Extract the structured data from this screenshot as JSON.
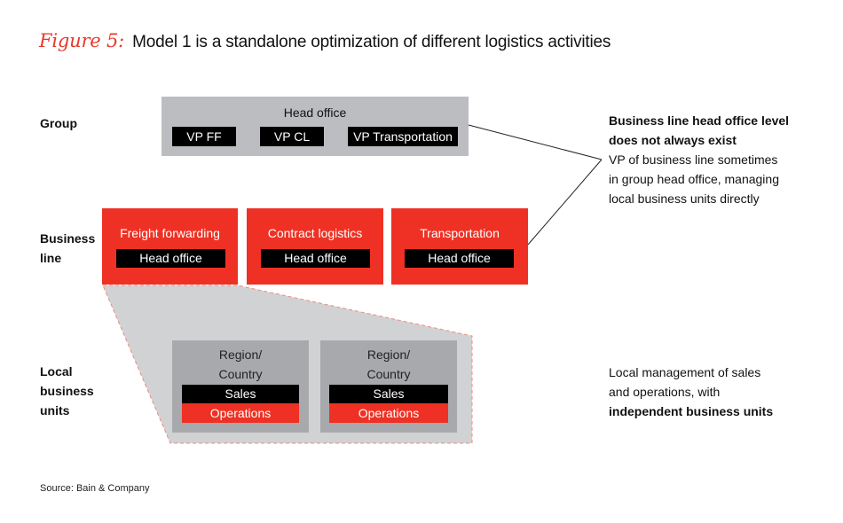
{
  "figure": {
    "label": "Figure 5:",
    "title": "Model 1 is a standalone optimization of different logistics activities"
  },
  "row_labels": {
    "group": "Group",
    "business_line": [
      "Business",
      "line"
    ],
    "local_units": [
      "Local",
      "business",
      "units"
    ]
  },
  "group_level": {
    "title": "Head office",
    "vps": [
      "VP FF",
      "VP CL",
      "VP Transportation"
    ]
  },
  "business_lines": [
    {
      "name": "Freight forwarding",
      "sub": "Head office"
    },
    {
      "name": "Contract logistics",
      "sub": "Head office"
    },
    {
      "name": "Transportation",
      "sub": "Head office"
    }
  ],
  "local_units": [
    {
      "title": [
        "Region/",
        "Country"
      ],
      "sales": "Sales",
      "operations": "Operations"
    },
    {
      "title": [
        "Region/",
        "Country"
      ],
      "sales": "Sales",
      "operations": "Operations"
    }
  ],
  "notes": {
    "top": {
      "bold_lines": [
        "Business line head office level",
        "does not always exist"
      ],
      "lines": [
        "VP of business line sometimes",
        "in group head office, managing",
        "local business units directly"
      ]
    },
    "bottom": {
      "lines": [
        "Local management of sales",
        "and operations, with"
      ],
      "bold_line": "independent business units"
    }
  },
  "source": "Source: Bain & Company",
  "colors": {
    "accent_red": "#ee3124",
    "gray_light": "#d1d2d4",
    "gray_mid": "#bcbdc0",
    "gray_dark": "#a7a9ac",
    "black": "#000000"
  }
}
